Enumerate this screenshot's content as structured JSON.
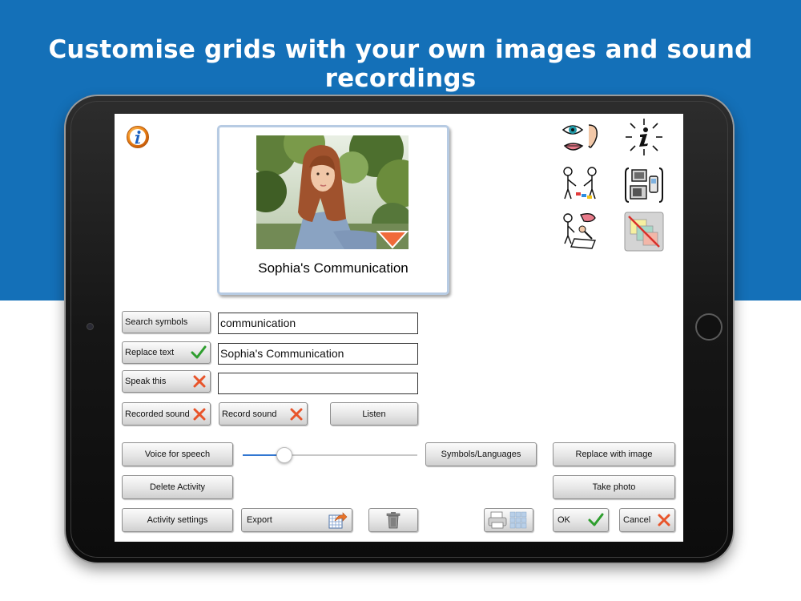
{
  "headline": "Customise grids with your own images and sound recordings",
  "card": {
    "title": "Sophia's Communication"
  },
  "fields": {
    "search_value": "communication",
    "replace_value": "Sophia's Communication",
    "speak_value": ""
  },
  "buttons": {
    "search_symbols": "Search symbols",
    "replace_text": "Replace text",
    "speak_this": "Speak this",
    "recorded_sound": "Recorded sound",
    "record_sound": "Record sound",
    "listen": "Listen",
    "voice_for_speech": "Voice for speech",
    "symbols_languages": "Symbols/Languages",
    "replace_with_image": "Replace with image",
    "delete_activity": "Delete Activity",
    "take_photo": "Take photo",
    "activity_settings": "Activity settings",
    "export": "Export",
    "ok": "OK",
    "cancel": "Cancel"
  },
  "slider": {
    "value_fraction": 0.24
  },
  "colors": {
    "banner": "#1470b8",
    "check": "#2e9e2e",
    "cross": "#e8542a",
    "accent": "#3277d2"
  },
  "icons": [
    "info-icon",
    "eye-ear-mouth-icon",
    "information-icon",
    "people-activity-icon",
    "devices-icon",
    "talk-write-icon",
    "no-image-icon",
    "check-icon",
    "cross-icon",
    "export-icon",
    "trash-icon",
    "printer-grid-icon"
  ]
}
